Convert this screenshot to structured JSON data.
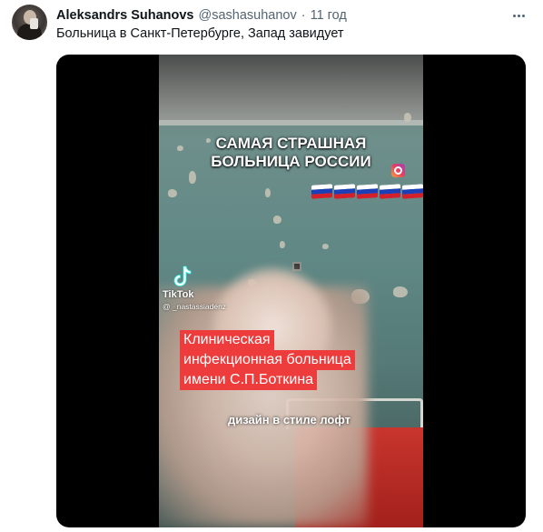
{
  "tweet": {
    "author_name": "Aleksandrs Suhanovs",
    "author_handle": "@sashasuhanov",
    "separator": "·",
    "timestamp": "11 год",
    "text": "Больница в Санкт-Петербурге, Запад завидует",
    "more_icon": "more-horizontal-icon"
  },
  "video": {
    "title_lines": [
      "САМАЯ СТРАШНАЯ",
      "БОЛЬНИЦА РОССИИ"
    ],
    "flag_count": 5,
    "tiktok_label": "TikTok",
    "tiktok_user": "@ _nastassiadenz",
    "caption_lines": [
      "Клиническая",
      "инфекционная больница",
      "имени С.П.Боткина"
    ],
    "subtitle": "дизайн в стиле лофт",
    "colors": {
      "caption_background": "#ee3b3b",
      "bed": "#c8352e",
      "wall": "#5f8784"
    }
  }
}
